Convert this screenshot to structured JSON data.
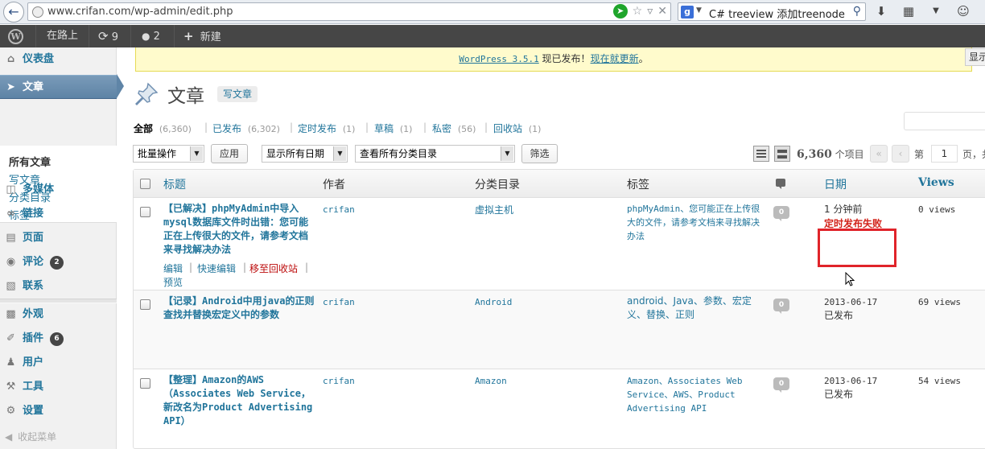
{
  "browser": {
    "url": "www.crifan.com/wp-admin/edit.php",
    "search_text": "C# treeview 添加treenode"
  },
  "admin_bar": {
    "site_name": "在路上",
    "updates_count": "9",
    "comments_count": "2",
    "new_label": "新建"
  },
  "notice": {
    "version_link": "WordPress 3.5.1",
    "text_mid": " 现已发布！",
    "update_link": "现在就更新",
    "text_end": "。"
  },
  "screen_options": "显示选项",
  "sidebar": {
    "dashboard": "仪表盘",
    "posts": "文章",
    "sub": [
      "所有文章",
      "写文章",
      "分类目录",
      "标签"
    ],
    "media": "多媒体",
    "links": "链接",
    "pages": "页面",
    "comments": "评论",
    "comments_badge": "2",
    "contact": "联系",
    "appearance": "外观",
    "plugins": "插件",
    "plugins_badge": "6",
    "users": "用户",
    "tools": "工具",
    "settings": "设置",
    "collapse": "收起菜单"
  },
  "page": {
    "title": "文章",
    "add_new": "写文章"
  },
  "filters": [
    {
      "label": "全部",
      "count": "(6,360)"
    },
    {
      "label": "已发布",
      "count": "(6,302)"
    },
    {
      "label": "定时发布",
      "count": "(1)"
    },
    {
      "label": "草稿",
      "count": "(1)"
    },
    {
      "label": "私密",
      "count": "(56)"
    },
    {
      "label": "回收站",
      "count": "(1)"
    }
  ],
  "tablenav": {
    "bulk_action": "批量操作",
    "apply": "应用",
    "date_filter": "显示所有日期",
    "cat_filter": "查看所有分类目录",
    "filter_btn": "筛选",
    "items_num": "6,360",
    "items_suffix": " 个项目",
    "first": "«",
    "prev": "‹",
    "page_prefix": "第",
    "page_value": "1",
    "page_suffix": "页，共"
  },
  "columns": {
    "title": "标题",
    "author": "作者",
    "categories": "分类目录",
    "tags": "标签",
    "date": "日期",
    "views": "Views"
  },
  "rows": [
    {
      "title": "【已解决】phpMyAdmin中导入mysql数据库文件时出错：您可能正在上传很大的文件，请参考文档来寻找解决办法",
      "author": "crifan",
      "category": "虚拟主机",
      "tags": "phpMyAdmin、您可能正在上传很大的文件，请参考文档来寻找解决办法",
      "comments": "0",
      "date_line1": "1 分钟前",
      "date_line2": "定时发布失败",
      "views": "0 views",
      "actions": {
        "edit": "编辑",
        "quick_edit": "快速编辑",
        "trash": "移至回收站",
        "preview": "预览"
      }
    },
    {
      "title": "【记录】Android中用java的正则查找并替换宏定义中的参数",
      "author": "crifan",
      "category": "Android",
      "tags": "android、Java、参数、宏定义、替换、正则",
      "comments": "0",
      "date_line1": "2013-06-17",
      "date_line2": "已发布",
      "views": "69 views"
    },
    {
      "title": "【整理】Amazon的AWS（Associates Web Service，新改名为Product Advertising API）",
      "author": "crifan",
      "category": "Amazon",
      "tags": "Amazon、Associates Web Service、AWS、Product Advertising API",
      "comments": "0",
      "date_line1": "2013-06-17",
      "date_line2": "已发布",
      "views": "54 views"
    }
  ],
  "colors": {
    "link": "#21759b",
    "active_menu": "#5d83a5",
    "fail_highlight": "#e0242a"
  }
}
